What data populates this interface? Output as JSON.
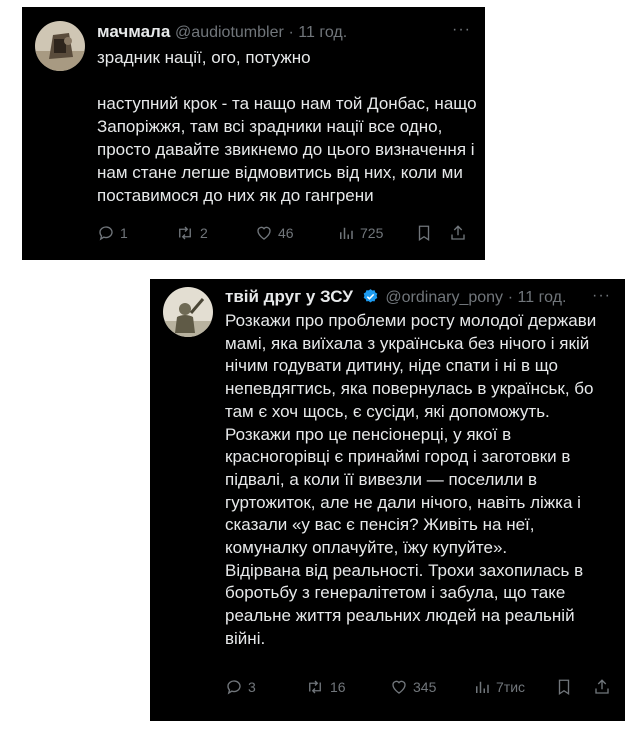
{
  "tweets": [
    {
      "name": "мачмала",
      "handle": "@audiotumbler",
      "time": "· 11 год.",
      "more": "···",
      "paragraphs": [
        "зрадник нації, ого, потужно",
        "наступний крок - та нащо нам той Донбас, нащо Запоріжжя, там всі зрадники нації все одно, просто давайте звикнемо до цього визначення і нам стане легше відмовитись від них, коли ми поставимося до них як до гангрени"
      ],
      "stats": {
        "replies": "1",
        "reposts": "2",
        "likes": "46",
        "views": "725"
      }
    },
    {
      "name": "твій друг у ЗСУ",
      "handle": "@ordinary_pony",
      "time": "· 11 год.",
      "more": "···",
      "paragraphs": [
        "Розкажи про проблеми росту молодої держави мамі, яка виїхала з українська без нічого і якій нічим годувати дитину, ніде спати і ні в що непевдягтись, яка повернулась в українськ, бо там є хоч щось, є сусіди, які допоможуть.",
        "Розкажи про це пенсіонерці, у якої в красногорівці є принаймі город і заготовки в підвалі, а коли її вивезли — поселили в гуртожиток, але не дали нічого, навіть ліжка і сказали «у вас є пенсія? Живіть на неї, комуналку оплачуйте, їжу купуйте».",
        "Відірвана від реальності. Трохи захопилась в боротьбу з генералітетом і забула, що таке реальне життя реальних людей на реальній війні."
      ],
      "stats": {
        "replies": "3",
        "reposts": "16",
        "likes": "345",
        "views": "7тис"
      }
    }
  ],
  "colors": {
    "background": "#000000",
    "text": "#e7e9ea",
    "muted": "#71767b",
    "verified": "#1d9bf0"
  },
  "icons": [
    "reply-icon",
    "repost-icon",
    "like-icon",
    "views-icon",
    "bookmark-icon",
    "share-icon",
    "verified-badge-icon",
    "more-icon"
  ]
}
